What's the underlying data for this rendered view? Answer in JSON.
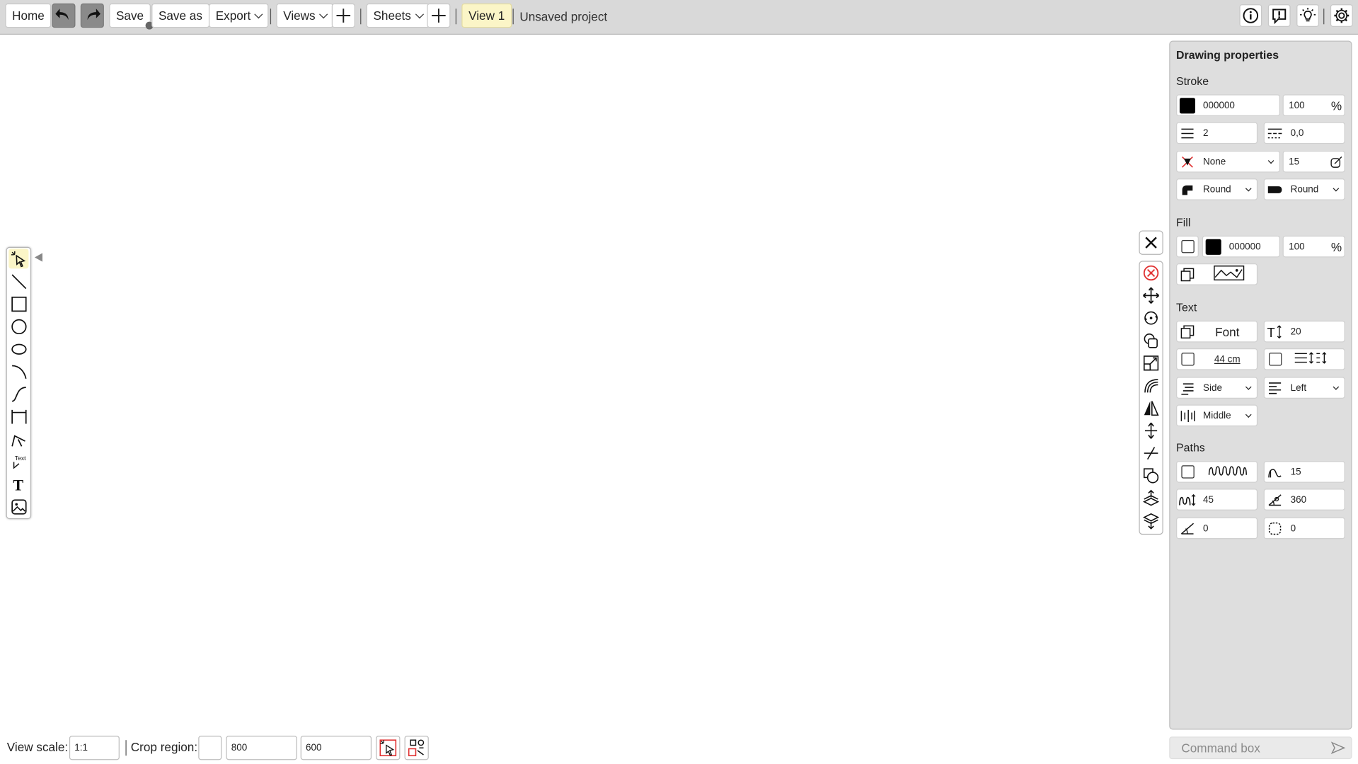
{
  "toolbar": {
    "home": "Home",
    "save": "Save",
    "save_as": "Save as",
    "export": "Export",
    "views": "Views",
    "sheets": "Sheets",
    "current_view": "View 1",
    "project_name": "Unsaved project",
    "right_icons": [
      "info-icon",
      "alert-icon",
      "lightbulb-icon",
      "settings-icon"
    ]
  },
  "left_tools": [
    "select-tool-icon",
    "line-tool-icon",
    "rectangle-tool-icon",
    "circle-tool-icon",
    "ellipse-tool-icon",
    "arc-tool-icon",
    "curve-tool-icon",
    "dimension-tool-icon",
    "polyline-tool-icon",
    "leader-text-tool-icon",
    "text-tool-icon",
    "image-tool-icon"
  ],
  "modifiers": [
    "delete-icon",
    "move-icon",
    "rotate-icon",
    "copy-icon",
    "scale-icon",
    "offset-icon",
    "mirror-icon",
    "stretch-icon",
    "trim-icon",
    "boolean-icon",
    "bring-forward-icon",
    "send-backward-icon"
  ],
  "panel": {
    "title": "Drawing properties",
    "stroke": {
      "label": "Stroke",
      "color": "000000",
      "opacity": "100",
      "width": "2",
      "dash": "0,0",
      "marker": "None",
      "marker_size": "15",
      "join": "Round",
      "cap": "Round"
    },
    "fill": {
      "label": "Fill",
      "color": "000000",
      "opacity": "100"
    },
    "text": {
      "label": "Text",
      "font": "Font",
      "size": "20",
      "width_label": "44 cm",
      "side": "Side",
      "align": "Left",
      "vertical": "Middle"
    },
    "paths": {
      "label": "Paths",
      "wave_amp": "15",
      "wave_len": "45",
      "angle": "360",
      "rotation": "0",
      "corner": "0"
    }
  },
  "bottom": {
    "view_scale_label": "View scale:",
    "view_scale": "1:1",
    "crop_label": "Crop region:",
    "crop_w": "800",
    "crop_h": "600"
  },
  "command_box": {
    "placeholder": "Command box"
  },
  "colors": {
    "stroke": "#000000",
    "fill": "#000000",
    "active": "#fbf5c7",
    "delete": "#e03030"
  }
}
